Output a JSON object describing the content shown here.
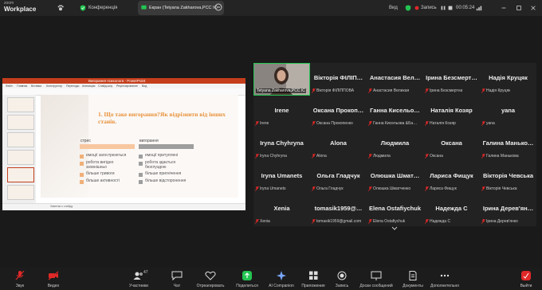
{
  "app": {
    "logo_top": "zoom",
    "logo_bottom": "Workplace"
  },
  "topbar": {
    "conference_label": "Конференція",
    "share_banner": "Екран (Tetyana Zakharova,PCC IC",
    "view_label": "Вид",
    "recording_label": "Запись",
    "timer": "00:05:24"
  },
  "presentation": {
    "title_bar": "Вигорання психолога - PowerPoint",
    "menu": [
      "Файл",
      "Главная",
      "Вставка",
      "Конструктор",
      "Переходы",
      "Анимация",
      "Слайд-шоу",
      "Рецензирование",
      "Вид"
    ],
    "slide_title": "1. Що таке вигорання?Як відрізнити від інших станів.",
    "col_left": "стрес",
    "col_right": "вигорання",
    "left_items": [
      "емоції загострюються",
      "робота вигідно ззовнішньо",
      "більше тривоги",
      "більше активності"
    ],
    "right_items": [
      "емоції притуплені",
      "робота здається безглуздою",
      "більше пригнічення",
      "більше відсторонення"
    ],
    "status": "Заметки к слайду"
  },
  "participants": [
    {
      "name": "Tetyana Zakharova,PCC IC",
      "label": "Tetyana Zakharova,PCC IC",
      "video": true
    },
    {
      "name": "Вікторія ФІЛІП…",
      "label": "Вікторія ФІЛІППОВА"
    },
    {
      "name": "Анастасия Вел…",
      "label": "Анастасия Великая"
    },
    {
      "name": "Ірина Безсмерт…",
      "label": "Ірина Безсмертна"
    },
    {
      "name": "Надія Круцяк",
      "label": "Надія Круцяк"
    },
    {
      "name": "Irene",
      "label": "Irene"
    },
    {
      "name": "Оксана Прокоп…",
      "label": "Оксана Прокопенко"
    },
    {
      "name": "Ганна Кисельо…",
      "label": "Ганна Кисельова &Ба…"
    },
    {
      "name": "Наталія Козяр",
      "label": "Наталія Козяр"
    },
    {
      "name": "yana",
      "label": "yana"
    },
    {
      "name": "Iryna Chyhryna",
      "label": "Iryna Chyhryna"
    },
    {
      "name": "Alona",
      "label": "Alona"
    },
    {
      "name": "Людмила",
      "label": "Людмила"
    },
    {
      "name": "Оксана",
      "label": "Оксана"
    },
    {
      "name": "Галина Манько…",
      "label": "Галина Манькова"
    },
    {
      "name": "Iryna Umanets",
      "label": "Iryna Umanets"
    },
    {
      "name": "Ольга Гладчук",
      "label": "Ольга Гладчук"
    },
    {
      "name": "Олюшка Шмат…",
      "label": "Олюшка Шматченко"
    },
    {
      "name": "Лариса Фищук",
      "label": "Лариса Фищук"
    },
    {
      "name": "Вікторія Чевська",
      "label": "Вікторія Чевська"
    },
    {
      "name": "Xenia",
      "label": "Xenia"
    },
    {
      "name": "tomasik1959@…",
      "label": "tomasik1959@gmail.com"
    },
    {
      "name": "Elena Ostafiychuk",
      "label": "Elena Ostafiychuk"
    },
    {
      "name": "Надежда С",
      "label": "Надежда С"
    },
    {
      "name": "Ірина Дерев'ян…",
      "label": "Ірина Дерев'янко"
    }
  ],
  "toolbar": {
    "audio": "Звук",
    "video": "Видео",
    "participants": "Участники",
    "participants_count": "47",
    "chat": "Чат",
    "react": "Отреагировать",
    "share": "Поделиться",
    "ai": "AI Companion",
    "apps": "Приложения",
    "record": "Запись",
    "whiteboards": "Доски сообщений",
    "docs": "Документы",
    "more": "Дополнительно",
    "leave": "Выйти"
  },
  "colors": {
    "green": "#23c552",
    "red": "#e02828",
    "orange": "#e8923a",
    "ppt_red": "#c43e1c"
  }
}
